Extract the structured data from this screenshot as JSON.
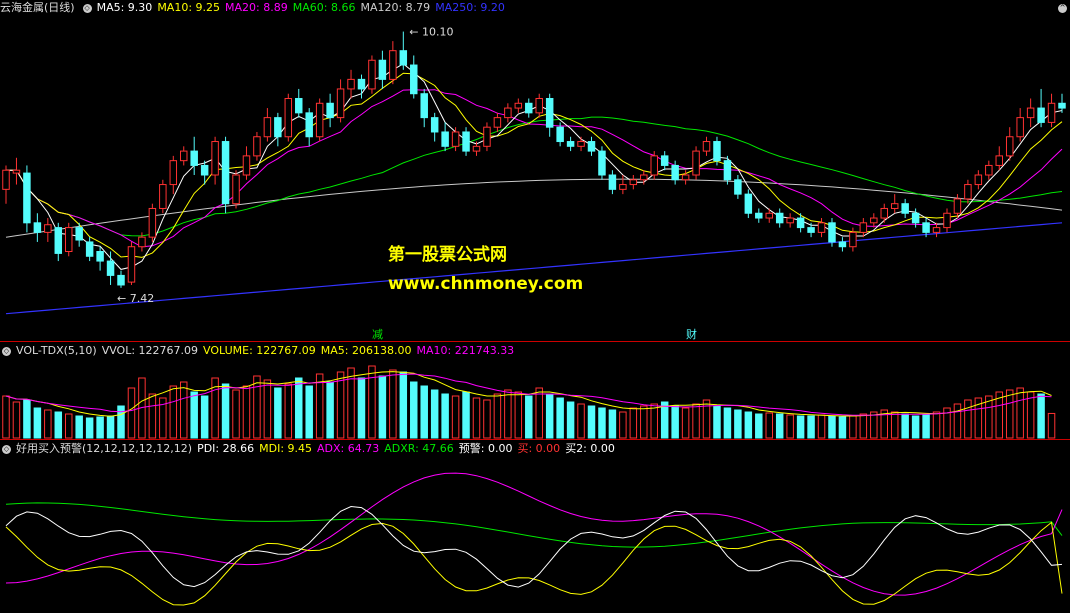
{
  "colors": {
    "up": "#ff3232",
    "down": "#54fcfc",
    "ma5": "#ffffff",
    "ma10": "#ffff00",
    "ma20": "#ff00ff",
    "ma60": "#00e600",
    "ma120": "#c8c8c8",
    "ma250": "#3333ff",
    "pdi": "#ffffff",
    "mdi": "#ffff00",
    "adx": "#ff00ff",
    "adxr": "#00e600",
    "alert": "#00ffff",
    "buy": "#ff3232",
    "watermark": "#ffff00"
  },
  "price_header": {
    "title": "云海金属(日线)",
    "ma5": "MA5: 9.30",
    "ma10": "MA10: 9.25",
    "ma20": "MA20: 8.89",
    "ma60": "MA60: 8.66",
    "ma120": "MA120: 8.79",
    "ma250": "MA250: 9.20"
  },
  "vol_header": {
    "title": "VOL-TDX(5,10)",
    "vvol": "VVOL: 122767.09",
    "volume": "VOLUME: 122767.09",
    "ma5": "MA5: 206138.00",
    "ma10": "MA10: 221743.33"
  },
  "ind_header": {
    "title": "好用买入预警(12,12,12,12,12,12)",
    "pdi": "PDI: 28.66",
    "mdi": "MDI: 9.45",
    "adx": "ADX: 64.73",
    "adxr": "ADXR: 47.66",
    "alert": "预警: 0.00",
    "buy": "买: 0.00",
    "buy2": "买2: 0.00"
  },
  "markers": {
    "high": "10.10",
    "low": "7.42",
    "flag1": "减",
    "flag2": "财"
  },
  "watermark": {
    "line1": "第一股票公式网",
    "line2": "www.chnmoney.com"
  },
  "chart_data": [
    {
      "type": "candlestick",
      "name": "云海金属(日线)",
      "ylim": [
        7.0,
        10.2
      ],
      "ohlc": [
        [
          8.45,
          8.65,
          8.3,
          8.7
        ],
        [
          8.62,
          8.65,
          8.5,
          8.78
        ],
        [
          8.62,
          8.1,
          8.0,
          8.7
        ],
        [
          8.1,
          8.0,
          7.9,
          8.2
        ],
        [
          8.0,
          8.08,
          7.9,
          8.15
        ],
        [
          8.05,
          7.78,
          7.7,
          8.1
        ],
        [
          7.8,
          8.05,
          7.75,
          8.1
        ],
        [
          8.05,
          7.92,
          7.85,
          8.1
        ],
        [
          7.9,
          7.75,
          7.7,
          7.95
        ],
        [
          7.8,
          7.7,
          7.6,
          7.85
        ],
        [
          7.7,
          7.55,
          7.45,
          7.8
        ],
        [
          7.55,
          7.45,
          7.42,
          7.6
        ],
        [
          7.48,
          7.85,
          7.45,
          7.9
        ],
        [
          7.85,
          7.95,
          7.8,
          8.0
        ],
        [
          7.95,
          8.25,
          7.9,
          8.3
        ],
        [
          8.25,
          8.5,
          8.2,
          8.55
        ],
        [
          8.5,
          8.75,
          8.4,
          8.8
        ],
        [
          8.75,
          8.85,
          8.7,
          8.9
        ],
        [
          8.85,
          8.7,
          8.6,
          9.0
        ],
        [
          8.7,
          8.6,
          8.5,
          8.75
        ],
        [
          8.6,
          8.95,
          8.5,
          9.0
        ],
        [
          8.95,
          8.3,
          8.2,
          9.0
        ],
        [
          8.3,
          8.6,
          8.25,
          8.65
        ],
        [
          8.6,
          8.8,
          8.55,
          8.9
        ],
        [
          8.8,
          9.0,
          8.75,
          9.05
        ],
        [
          9.0,
          9.2,
          8.95,
          9.3
        ],
        [
          9.2,
          9.0,
          8.9,
          9.25
        ],
        [
          9.0,
          9.4,
          8.95,
          9.45
        ],
        [
          9.4,
          9.25,
          9.2,
          9.5
        ],
        [
          9.25,
          9.0,
          8.9,
          9.3
        ],
        [
          9.0,
          9.35,
          8.95,
          9.4
        ],
        [
          9.35,
          9.2,
          9.1,
          9.45
        ],
        [
          9.2,
          9.5,
          9.15,
          9.6
        ],
        [
          9.5,
          9.6,
          9.4,
          9.7
        ],
        [
          9.6,
          9.5,
          9.4,
          9.65
        ],
        [
          9.5,
          9.8,
          9.45,
          9.85
        ],
        [
          9.8,
          9.6,
          9.5,
          9.9
        ],
        [
          9.6,
          9.9,
          9.55,
          10.0
        ],
        [
          9.9,
          9.75,
          9.7,
          10.1
        ],
        [
          9.75,
          9.45,
          9.4,
          9.85
        ],
        [
          9.45,
          9.2,
          9.1,
          9.5
        ],
        [
          9.2,
          9.05,
          8.95,
          9.25
        ],
        [
          9.05,
          8.9,
          8.85,
          9.15
        ],
        [
          8.9,
          9.05,
          8.85,
          9.1
        ],
        [
          9.05,
          8.85,
          8.8,
          9.1
        ],
        [
          8.85,
          8.9,
          8.8,
          8.95
        ],
        [
          8.9,
          9.1,
          8.85,
          9.15
        ],
        [
          9.1,
          9.2,
          9.05,
          9.25
        ],
        [
          9.2,
          9.3,
          9.15,
          9.35
        ],
        [
          9.3,
          9.35,
          9.25,
          9.4
        ],
        [
          9.35,
          9.25,
          9.2,
          9.4
        ],
        [
          9.25,
          9.4,
          9.2,
          9.45
        ],
        [
          9.4,
          9.1,
          9.0,
          9.45
        ],
        [
          9.1,
          8.95,
          8.9,
          9.15
        ],
        [
          8.95,
          8.9,
          8.85,
          9.0
        ],
        [
          8.9,
          8.95,
          8.85,
          9.0
        ],
        [
          8.95,
          8.85,
          8.8,
          9.0
        ],
        [
          8.85,
          8.6,
          8.55,
          8.9
        ],
        [
          8.6,
          8.45,
          8.4,
          8.65
        ],
        [
          8.45,
          8.5,
          8.4,
          8.6
        ],
        [
          8.5,
          8.55,
          8.45,
          8.6
        ],
        [
          8.55,
          8.6,
          8.5,
          8.65
        ],
        [
          8.6,
          8.8,
          8.55,
          8.85
        ],
        [
          8.8,
          8.7,
          8.65,
          8.85
        ],
        [
          8.7,
          8.55,
          8.5,
          8.75
        ],
        [
          8.55,
          8.6,
          8.5,
          8.65
        ],
        [
          8.6,
          8.85,
          8.55,
          8.9
        ],
        [
          8.85,
          8.95,
          8.8,
          9.0
        ],
        [
          8.95,
          8.75,
          8.7,
          9.0
        ],
        [
          8.75,
          8.55,
          8.5,
          8.8
        ],
        [
          8.55,
          8.4,
          8.35,
          8.6
        ],
        [
          8.4,
          8.2,
          8.15,
          8.45
        ],
        [
          8.2,
          8.15,
          8.1,
          8.25
        ],
        [
          8.15,
          8.2,
          8.1,
          8.25
        ],
        [
          8.2,
          8.1,
          8.05,
          8.25
        ],
        [
          8.1,
          8.15,
          8.05,
          8.2
        ],
        [
          8.15,
          8.05,
          8.0,
          8.2
        ],
        [
          8.05,
          8.0,
          7.95,
          8.1
        ],
        [
          8.0,
          8.1,
          7.95,
          8.15
        ],
        [
          8.1,
          7.9,
          7.85,
          8.15
        ],
        [
          7.9,
          7.85,
          7.8,
          7.95
        ],
        [
          7.85,
          8.0,
          7.8,
          8.05
        ],
        [
          8.0,
          8.1,
          7.95,
          8.15
        ],
        [
          8.1,
          8.15,
          8.05,
          8.2
        ],
        [
          8.15,
          8.25,
          8.1,
          8.3
        ],
        [
          8.25,
          8.3,
          8.2,
          8.4
        ],
        [
          8.3,
          8.2,
          8.15,
          8.35
        ],
        [
          8.2,
          8.1,
          8.05,
          8.25
        ],
        [
          8.1,
          8.0,
          7.95,
          8.15
        ],
        [
          8.0,
          8.05,
          7.95,
          8.1
        ],
        [
          8.05,
          8.2,
          8.0,
          8.25
        ],
        [
          8.2,
          8.35,
          8.15,
          8.4
        ],
        [
          8.35,
          8.5,
          8.3,
          8.55
        ],
        [
          8.5,
          8.6,
          8.45,
          8.65
        ],
        [
          8.6,
          8.7,
          8.55,
          8.75
        ],
        [
          8.7,
          8.8,
          8.65,
          8.9
        ],
        [
          8.8,
          9.0,
          8.75,
          9.1
        ],
        [
          9.0,
          9.2,
          8.95,
          9.3
        ],
        [
          9.2,
          9.3,
          9.1,
          9.4
        ],
        [
          9.3,
          9.15,
          9.1,
          9.5
        ],
        [
          9.15,
          9.35,
          9.1,
          9.45
        ],
        [
          9.35,
          9.3,
          9.25,
          9.45
        ]
      ],
      "ma": {
        "MA5": 9.3,
        "MA10": 9.25,
        "MA20": 8.89,
        "MA60": 8.66,
        "MA120": 8.79,
        "MA250": 9.2
      },
      "annotations": [
        "10.10",
        "7.42"
      ]
    },
    {
      "type": "bar",
      "name": "VOL-TDX(5,10)",
      "series": [
        {
          "name": "VOLUME",
          "values": [
            210000,
            180000,
            190000,
            150000,
            140000,
            130000,
            120000,
            110000,
            100000,
            105000,
            110000,
            160000,
            250000,
            300000,
            220000,
            200000,
            260000,
            280000,
            230000,
            210000,
            300000,
            270000,
            240000,
            260000,
            310000,
            290000,
            250000,
            270000,
            300000,
            260000,
            320000,
            280000,
            330000,
            350000,
            300000,
            360000,
            310000,
            340000,
            330000,
            280000,
            260000,
            240000,
            220000,
            210000,
            230000,
            200000,
            190000,
            220000,
            240000,
            230000,
            210000,
            250000,
            220000,
            200000,
            180000,
            170000,
            160000,
            150000,
            140000,
            130000,
            150000,
            160000,
            170000,
            180000,
            160000,
            150000,
            170000,
            190000,
            160000,
            150000,
            140000,
            130000,
            120000,
            125000,
            120000,
            115000,
            110000,
            110000,
            115000,
            110000,
            105000,
            110000,
            120000,
            130000,
            140000,
            130000,
            120000,
            110000,
            115000,
            130000,
            150000,
            170000,
            190000,
            200000,
            210000,
            230000,
            240000,
            250000,
            230000,
            220000,
            122767.09
          ]
        }
      ],
      "ma": {
        "MA5": 206138.0,
        "MA10": 221743.33
      }
    },
    {
      "type": "line",
      "name": "好用买入预警(12,12,12,12,12,12)",
      "series": [
        {
          "name": "PDI",
          "last": 28.66
        },
        {
          "name": "MDI",
          "last": 9.45
        },
        {
          "name": "ADX",
          "last": 64.73
        },
        {
          "name": "ADXR",
          "last": 47.66
        },
        {
          "name": "预警",
          "last": 0.0
        },
        {
          "name": "买",
          "last": 0.0
        },
        {
          "name": "买2",
          "last": 0.0
        }
      ]
    }
  ]
}
